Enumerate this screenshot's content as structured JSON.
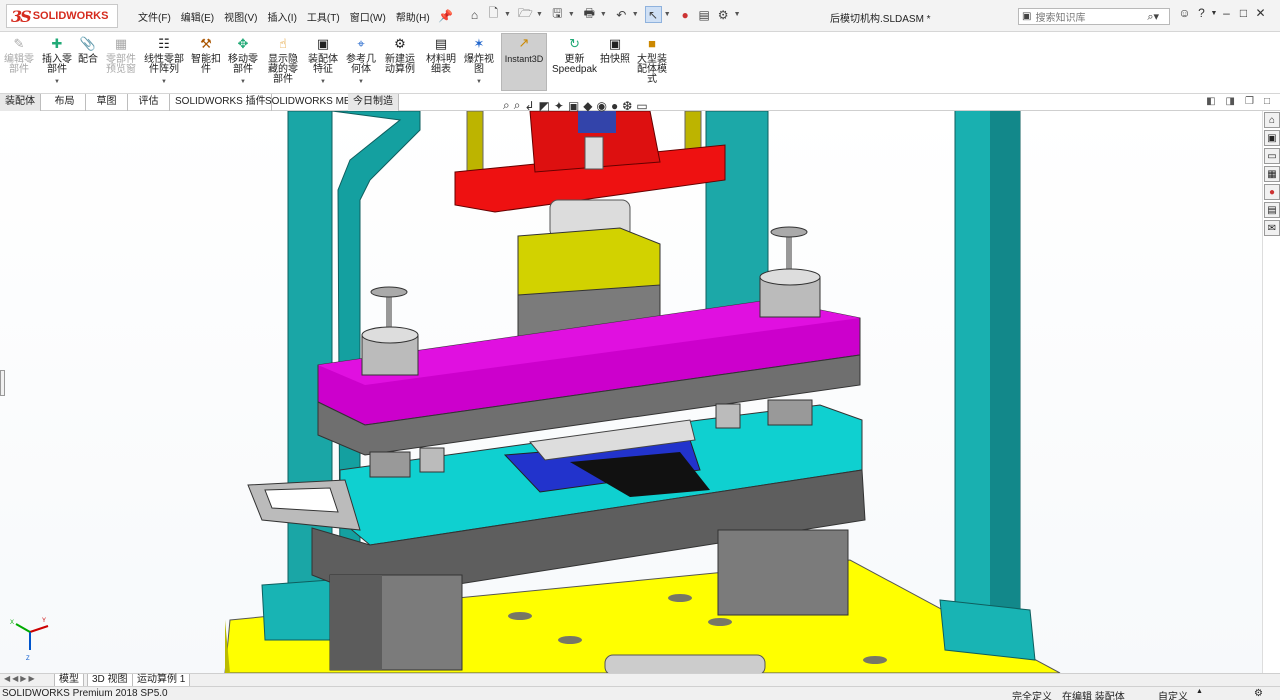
{
  "app": {
    "logo_text": "SOLIDWORKS",
    "logo_mark": "3S",
    "document_title": "后模切机构.SLDASM *"
  },
  "menu": [
    "文件(F)",
    "编辑(E)",
    "视图(V)",
    "插入(I)",
    "工具(T)",
    "窗口(W)",
    "帮助(H)"
  ],
  "search": {
    "placeholder": "搜索知识库"
  },
  "quick_access": [
    "home-icon",
    "new-doc-icon",
    "open-icon",
    "save-icon",
    "print-icon",
    "undo-icon",
    "select-arrow-icon",
    "traffic-light-icon",
    "file-props-icon",
    "gear-icon"
  ],
  "ribbon": [
    {
      "label": "编辑零\n部件",
      "icon": "edit-part-icon",
      "enabled": false
    },
    {
      "label": "插入零\n部件",
      "icon": "insert-part-icon",
      "enabled": true
    },
    {
      "label": "配合",
      "icon": "mate-icon",
      "enabled": true
    },
    {
      "label": "零部件\n预览窗",
      "icon": "preview-icon",
      "enabled": false
    },
    {
      "label": "线性零部\n件阵列",
      "icon": "pattern-icon",
      "enabled": true
    },
    {
      "label": "智能扣\n件",
      "icon": "fastener-icon",
      "enabled": true
    },
    {
      "label": "移动零\n部件",
      "icon": "move-part-icon",
      "enabled": true
    },
    {
      "label": "显示隐\n藏的零\n部件",
      "icon": "show-hidden-icon",
      "enabled": true
    },
    {
      "label": "装配体\n特征",
      "icon": "assembly-feature-icon",
      "enabled": true
    },
    {
      "label": "参考几\n何体",
      "icon": "ref-geometry-icon",
      "enabled": true
    },
    {
      "label": "新建运\n动算例",
      "icon": "motion-study-icon",
      "enabled": true
    },
    {
      "label": "材料明\n细表",
      "icon": "bom-icon",
      "enabled": true
    },
    {
      "label": "爆炸视\n图",
      "icon": "explode-icon",
      "enabled": true
    },
    {
      "label": "Instant3D",
      "icon": "instant3d-icon",
      "enabled": true
    },
    {
      "label": "更新\nSpeedpak",
      "icon": "speedpak-icon",
      "enabled": true
    },
    {
      "label": "拍快照",
      "icon": "camera-icon",
      "enabled": true
    },
    {
      "label": "大型装\n配体模\n式",
      "icon": "large-assembly-icon",
      "enabled": true
    }
  ],
  "tabs": [
    "装配体",
    "布局",
    "草图",
    "评估",
    "SOLIDWORKS 插件",
    "SOLIDWORKS MBD",
    "今日制造"
  ],
  "bottom_tabs": [
    "模型",
    "3D 视图",
    "运动算例 1"
  ],
  "status": {
    "product": "SOLIDWORKS Premium 2018 SP5.0",
    "custom_def": "完全定义",
    "editing": "在编辑 装配体",
    "custom": "自定义"
  },
  "colors": {
    "cyan": "#00c8c8",
    "teal": "#1aa3a3",
    "red": "#ee1111",
    "magenta": "#d000d0",
    "yellow": "#ffff00",
    "olive": "#c8c800",
    "gray": "#7a7a7a",
    "blue": "#2233cc"
  }
}
